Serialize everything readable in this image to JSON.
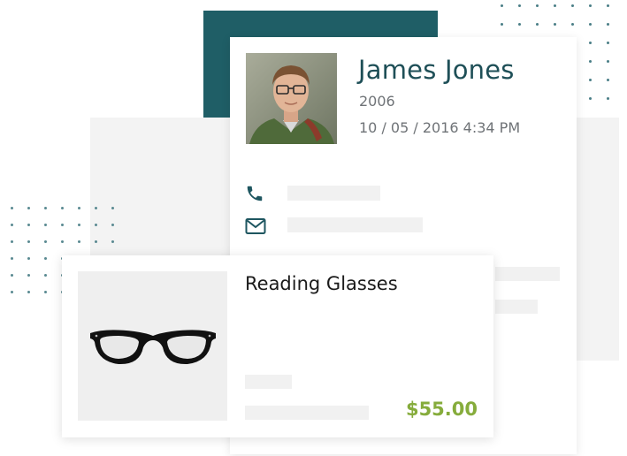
{
  "profile": {
    "name": "James Jones",
    "year": "2006",
    "datetime": "10 / 05 / 2016 4:34 PM",
    "avatar_icon": "person-photo",
    "phone_icon": "phone-icon",
    "mail_icon": "mail-icon"
  },
  "product": {
    "title": "Reading Glasses",
    "price": "$55.00",
    "image_icon": "glasses-icon"
  },
  "colors": {
    "teal": "#1f5e66",
    "price_green": "#86ac3c",
    "name_text": "#1e4f57"
  }
}
